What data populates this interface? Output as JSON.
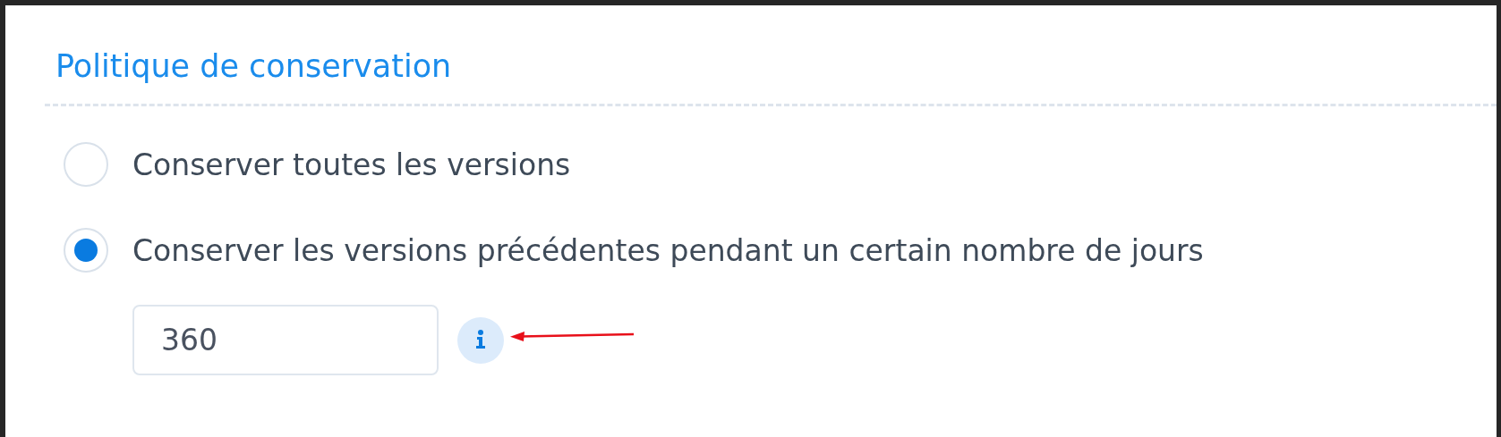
{
  "section": {
    "title": "Politique de conservation"
  },
  "options": [
    {
      "label": "Conserver toutes les versions",
      "selected": false
    },
    {
      "label": "Conserver les versions précédentes pendant un certain nombre de jours",
      "selected": true
    }
  ],
  "days_field": {
    "value": "360"
  }
}
